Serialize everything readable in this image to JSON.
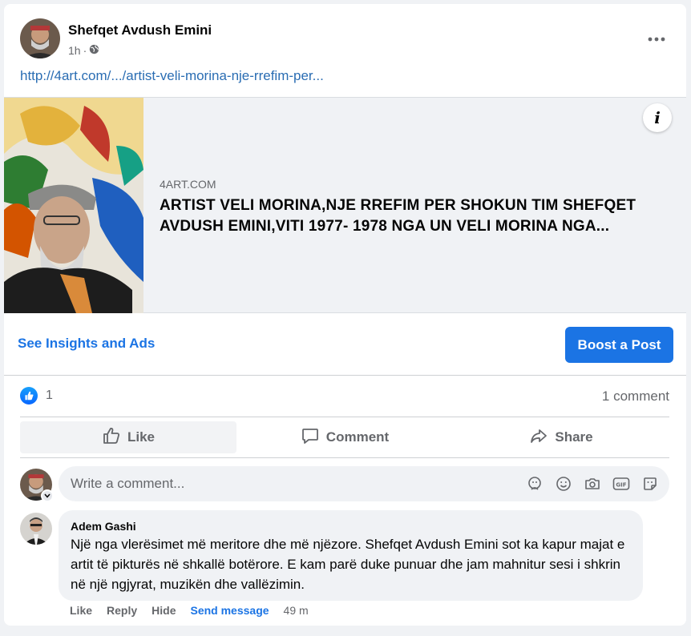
{
  "post": {
    "author": "Shefqet Avdush Emini",
    "time": "1h",
    "privacy_separator": "·",
    "more_icon": "more-horizontal-icon",
    "link_url_text": "http://4art.com/.../artist-veli-morina-nje-rrefim-per...",
    "preview": {
      "domain": "4ART.COM",
      "title": "ARTIST VELI MORINA,NJE RREFIM PER SHOKUN TIM SHEFQET AVDUSH EMINI,VITI 1977- 1978 NGA UN VELI MORINA NGA...",
      "info_label": "i"
    },
    "insights_label": "See Insights and Ads",
    "boost_label": "Boost a Post",
    "reaction_count": "1",
    "comment_count": "1 comment",
    "actions": {
      "like": "Like",
      "comment": "Comment",
      "share": "Share"
    },
    "write_comment_placeholder": "Write a comment...",
    "comment": {
      "author": "Adem Gashi",
      "text": "Një nga vlerësimet më meritore dhe më njëzore. Shefqet Avdush Emini sot ka kapur majat e artit të pikturës në shkallë botërore. E kam parë duke punuar dhe jam mahnitur sesi i shkrin në një ngjyrat, muzikën dhe vallëzimin.",
      "actions": {
        "like": "Like",
        "reply": "Reply",
        "hide": "Hide",
        "send_message": "Send message",
        "time": "49 m"
      }
    }
  },
  "colors": {
    "brand_blue": "#1b74e4",
    "link_blue": "#2a6db3",
    "secondary_text": "#65676b",
    "bubble_bg": "#f0f2f5"
  }
}
